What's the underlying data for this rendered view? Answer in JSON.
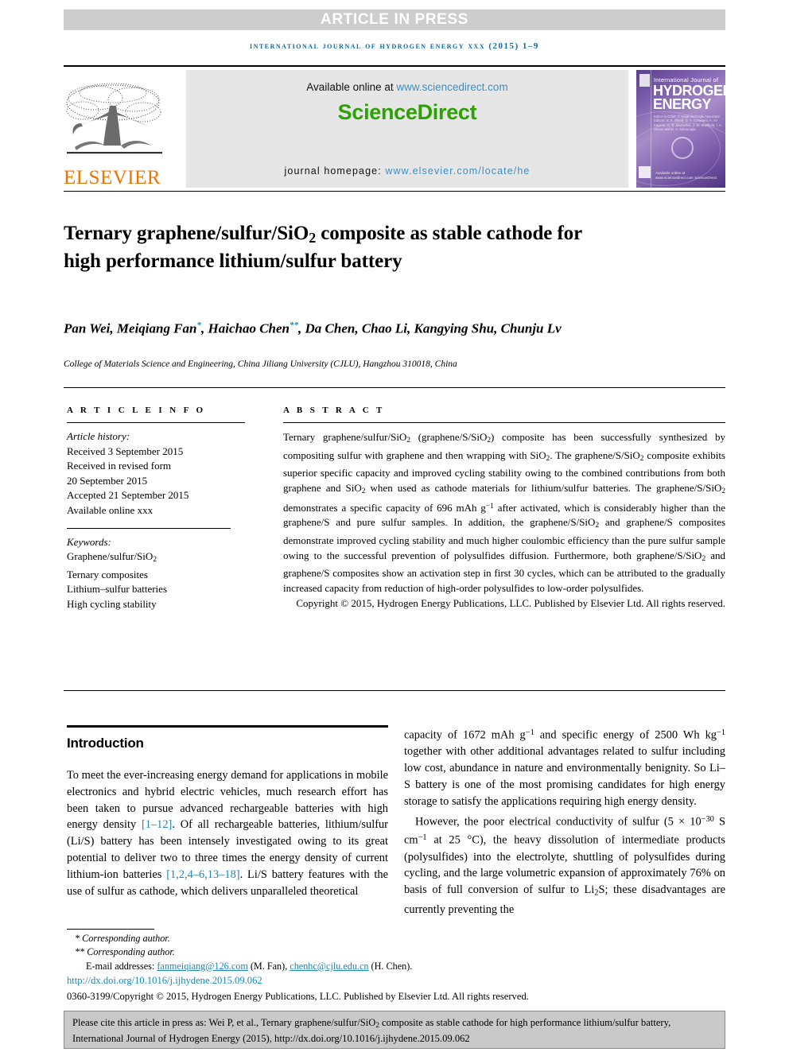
{
  "banner": {
    "text": "ARTICLE IN PRESS"
  },
  "journal_ref": "International Journal of Hydrogen Energy xxx (2015) 1–9",
  "masthead": {
    "publisher_name": "ELSEVIER",
    "available_online_label": "Available online at ",
    "available_online_url": "www.sciencedirect.com",
    "sciencedirect_logo": "ScienceDirect",
    "homepage_label": "journal homepage: ",
    "homepage_url": "www.elsevier.com/locate/he",
    "cover": {
      "line1": "International Journal of",
      "line2": "HYDROGEN",
      "line3": "ENERGY",
      "editors": "Editor-in-Chief: T. Nejat Veziroglu   Associate Editors: S. A. Sherif, D. Y. Goswami, A. Al-Kayiem, G. E. Marnellos, J. W. Sheffield, I. A. Dincer and E. A. Amouroglu",
      "sd_credit": "Available online at www.sciencedirect.com  ScienceDirect"
    }
  },
  "article": {
    "title_html": "Ternary graphene/sulfur/SiO<sub>2</sub> composite as stable cathode for high performance lithium/sulfur battery",
    "authors_html": "Pan Wei, Meiqiang Fan<sup>*</sup>, Haichao Chen<sup>**</sup>, Da Chen, Chao Li, Kangying Shu, Chunju Lv",
    "affiliation": "College of Materials Science and Engineering, China Jiliang University (CJLU), Hangzhou 310018, China"
  },
  "article_info": {
    "heading": "A R T I C L E   I N F O",
    "history_label": "Article history:",
    "history": [
      "Received 3 September 2015",
      "Received in revised form",
      "20 September 2015",
      "Accepted 21 September 2015",
      "Available online xxx"
    ],
    "keywords_label": "Keywords:",
    "keywords_html": [
      "Graphene/sulfur/SiO<sub>2</sub>",
      "Ternary composites",
      "Lithium–sulfur batteries",
      "High cycling stability"
    ]
  },
  "abstract": {
    "heading": "A B S T R A C T",
    "text_html": "Ternary graphene/sulfur/SiO<sub>2</sub> (graphene/S/SiO<sub>2</sub>) composite has been successfully synthesized by compositing sulfur with graphene and then wrapping with SiO<sub>2</sub>. The graphene/S/SiO<sub>2</sub> composite exhibits superior specific capacity and improved cycling stability owing to the combined contributions from both graphene and SiO<sub>2</sub> when used as cathode materials for lithium/sulfur batteries. The graphene/S/SiO<sub>2</sub> demonstrates a specific capacity of 696 mAh g<sup class=\"txt\">−1</sup> after activated, which is considerably higher than the graphene/S and pure sulfur samples. In addition, the graphene/S/SiO<sub>2</sub> and graphene/S composites demonstrate improved cycling stability and much higher coulombic efficiency than the pure sulfur sample owing to the successful prevention of polysulfides diffusion. Furthermore, both graphene/S/SiO<sub>2</sub> and graphene/S composites show an activation step in first 30 cycles, which can be attributed to the gradually increased capacity from reduction of high-order polysulfides to low-order polysulfides.",
    "copyright": "Copyright © 2015, Hydrogen Energy Publications, LLC. Published by Elsevier Ltd. All rights reserved."
  },
  "introduction": {
    "heading": "Introduction",
    "para1_html": "To meet the ever-increasing energy demand for applications in mobile electronics and hybrid electric vehicles, much research effort has been taken to pursue advanced rechargeable batteries with high energy density <span class=\"ref\">[1–12]</span>. Of all rechargeable batteries, lithium/sulfur (Li/S) battery has been intensely investigated owing to its great potential to deliver two to three times the energy density of current lithium-ion batteries <span class=\"ref\">[1,2,4–6,13–18]</span>. Li/S battery features with the use of sulfur as cathode, which delivers unparalleled theoretical capacity of 1672 mAh g<sup class=\"txt\">−1</sup> and specific energy of 2500 Wh kg<sup class=\"txt\">−1</sup> together with other additional advantages related to sulfur including low cost, abundance in nature and environmentally benignity. So Li–S battery is one of the most promising candidates for high energy storage to satisfy the applications requiring high energy density.",
    "para2_html": "However, the poor electrical conductivity of sulfur (5 × 10<sup class=\"txt\">−30</sup> S cm<sup class=\"txt\">−1</sup> at 25 °C), the heavy dissolution of intermediate products (polysulfides) into the electrolyte, shuttling of polysulfides during cycling, and the large volumetric expansion of approximately 76% on basis of full conversion of sulfur to Li<sub>2</sub>S; these disadvantages are currently preventing the"
  },
  "footnotes": {
    "corresponding1": "Corresponding author.",
    "corresponding2": "Corresponding author.",
    "email_label": "E-mail addresses: ",
    "email1": "fanmeiqiang@126.com",
    "email1_person": " (M. Fan), ",
    "email2": "chenhc@cjlu.edu.cn",
    "email2_person": " (H. Chen).",
    "doi": "http://dx.doi.org/10.1016/j.ijhydene.2015.09.062",
    "issn_line": "0360-3199/Copyright © 2015, Hydrogen Energy Publications, LLC. Published by Elsevier Ltd. All rights reserved."
  },
  "citation_box": {
    "text_html": "Please cite this article in press as: Wei P, et al., Ternary graphene/sulfur/SiO<sub>2</sub> composite as stable cathode for high performance lithium/sulfur battery, International Journal of Hydrogen Energy (2015), http://dx.doi.org/10.1016/j.ijhydene.2015.09.062"
  },
  "colors": {
    "banner_bg": "#cdcdcd",
    "journal_ref": "#0b6aa2",
    "elsevier_orange": "#ec7404",
    "sciencedirect_green": "#2ba102",
    "link_blue": "#3d8fc4",
    "ref_blue": "#1c87b8",
    "cite_box_bg": "#c9c9c9",
    "masthead_bg": "#e6e6e6"
  }
}
